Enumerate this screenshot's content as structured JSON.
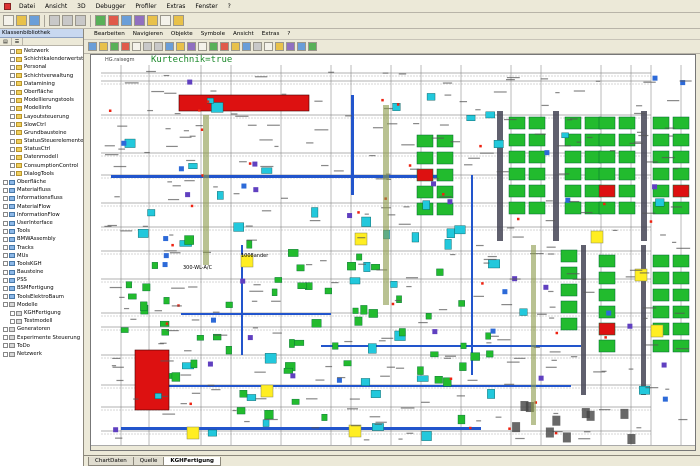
{
  "menubar": {
    "items": [
      "Datei",
      "Ansicht",
      "3D",
      "Debugger",
      "Profiler",
      "Extras",
      "Fenster",
      "?"
    ]
  },
  "left_panel": {
    "title": "Klassenbibliothek",
    "tree": [
      {
        "label": "Netzwerk",
        "kind": "folder",
        "indent": 1
      },
      {
        "label": "Schichtkalenderwertsteuerung",
        "kind": "folder",
        "indent": 1
      },
      {
        "label": "Personal",
        "kind": "folder",
        "indent": 1
      },
      {
        "label": "Schichtverwaltung",
        "kind": "folder",
        "indent": 1
      },
      {
        "label": "Datamining",
        "kind": "folder",
        "indent": 1
      },
      {
        "label": "Oberfläche",
        "kind": "folder",
        "indent": 1
      },
      {
        "label": "Modellierungstools",
        "kind": "folder",
        "indent": 1
      },
      {
        "label": "Modellinfo",
        "kind": "folder",
        "indent": 1
      },
      {
        "label": "Layoutsteuerung",
        "kind": "folder",
        "indent": 1
      },
      {
        "label": "SlowCtrl",
        "kind": "folder",
        "indent": 1
      },
      {
        "label": "Grundbausteine",
        "kind": "folder",
        "indent": 1
      },
      {
        "label": "StatusSteuerelemente",
        "kind": "folder",
        "indent": 1
      },
      {
        "label": "StatusCtrl",
        "kind": "folder",
        "indent": 1
      },
      {
        "label": "Datenmodell",
        "kind": "folder",
        "indent": 1
      },
      {
        "label": "ConsumptionControl",
        "kind": "folder",
        "indent": 1
      },
      {
        "label": "DialogTools",
        "kind": "folder",
        "indent": 1
      },
      {
        "label": "Oberfläche",
        "kind": "lib",
        "indent": 0
      },
      {
        "label": "Materialfluss",
        "kind": "lib",
        "indent": 0
      },
      {
        "label": "Informationsfluss",
        "kind": "lib",
        "indent": 0
      },
      {
        "label": "MaterialFlow",
        "kind": "lib",
        "indent": 0
      },
      {
        "label": "InformationFlow",
        "kind": "lib",
        "indent": 0
      },
      {
        "label": "UserInterface",
        "kind": "lib",
        "indent": 0
      },
      {
        "label": "Tools",
        "kind": "lib",
        "indent": 0
      },
      {
        "label": "BMWAssembly",
        "kind": "lib",
        "indent": 0
      },
      {
        "label": "Tracks",
        "kind": "lib",
        "indent": 0
      },
      {
        "label": "MUs",
        "kind": "lib",
        "indent": 0
      },
      {
        "label": "ToolsKGH",
        "kind": "lib",
        "indent": 0
      },
      {
        "label": "Bausteine",
        "kind": "lib",
        "indent": 0
      },
      {
        "label": "PSS",
        "kind": "lib",
        "indent": 0
      },
      {
        "label": "BSMFertigung",
        "kind": "lib",
        "indent": 0
      },
      {
        "label": "ToolsElektroBaum",
        "kind": "lib",
        "indent": 0
      },
      {
        "label": "Modelle",
        "kind": "mod",
        "indent": 0
      },
      {
        "label": "KGHFertigung",
        "kind": "mod",
        "indent": 1
      },
      {
        "label": "Testmodell",
        "kind": "mod",
        "indent": 1
      },
      {
        "label": "Generatoren",
        "kind": "mod",
        "indent": 0
      },
      {
        "label": "Experimente Steuerung",
        "kind": "mod",
        "indent": 0
      },
      {
        "label": "ToDo",
        "kind": "mod",
        "indent": 0
      },
      {
        "label": "Netzwerk",
        "kind": "mod",
        "indent": 0
      }
    ]
  },
  "doc_menu": {
    "items": [
      "Bearbeiten",
      "Navigieren",
      "Objekte",
      "Symbole",
      "Ansicht",
      "Extras",
      "?"
    ]
  },
  "canvas": {
    "frame_name": "HG.raisegm",
    "annotation": "Kurtechnik=true",
    "label_a": "1008ander",
    "label_b": "300-WL-A/C"
  },
  "tabs": {
    "items": [
      {
        "label": "ChartDaten",
        "active": false
      },
      {
        "label": "Quelle",
        "active": false
      },
      {
        "label": "KGHFertigung",
        "active": true
      }
    ]
  },
  "colors": {
    "station_green": "#22bb2e",
    "station_red": "#dd1111",
    "buffer_cyan": "#22c8dc",
    "conveyor_blue": "#2255cc",
    "marker_yellow": "#ffee22",
    "annotation_green": "#1d8a2c"
  }
}
